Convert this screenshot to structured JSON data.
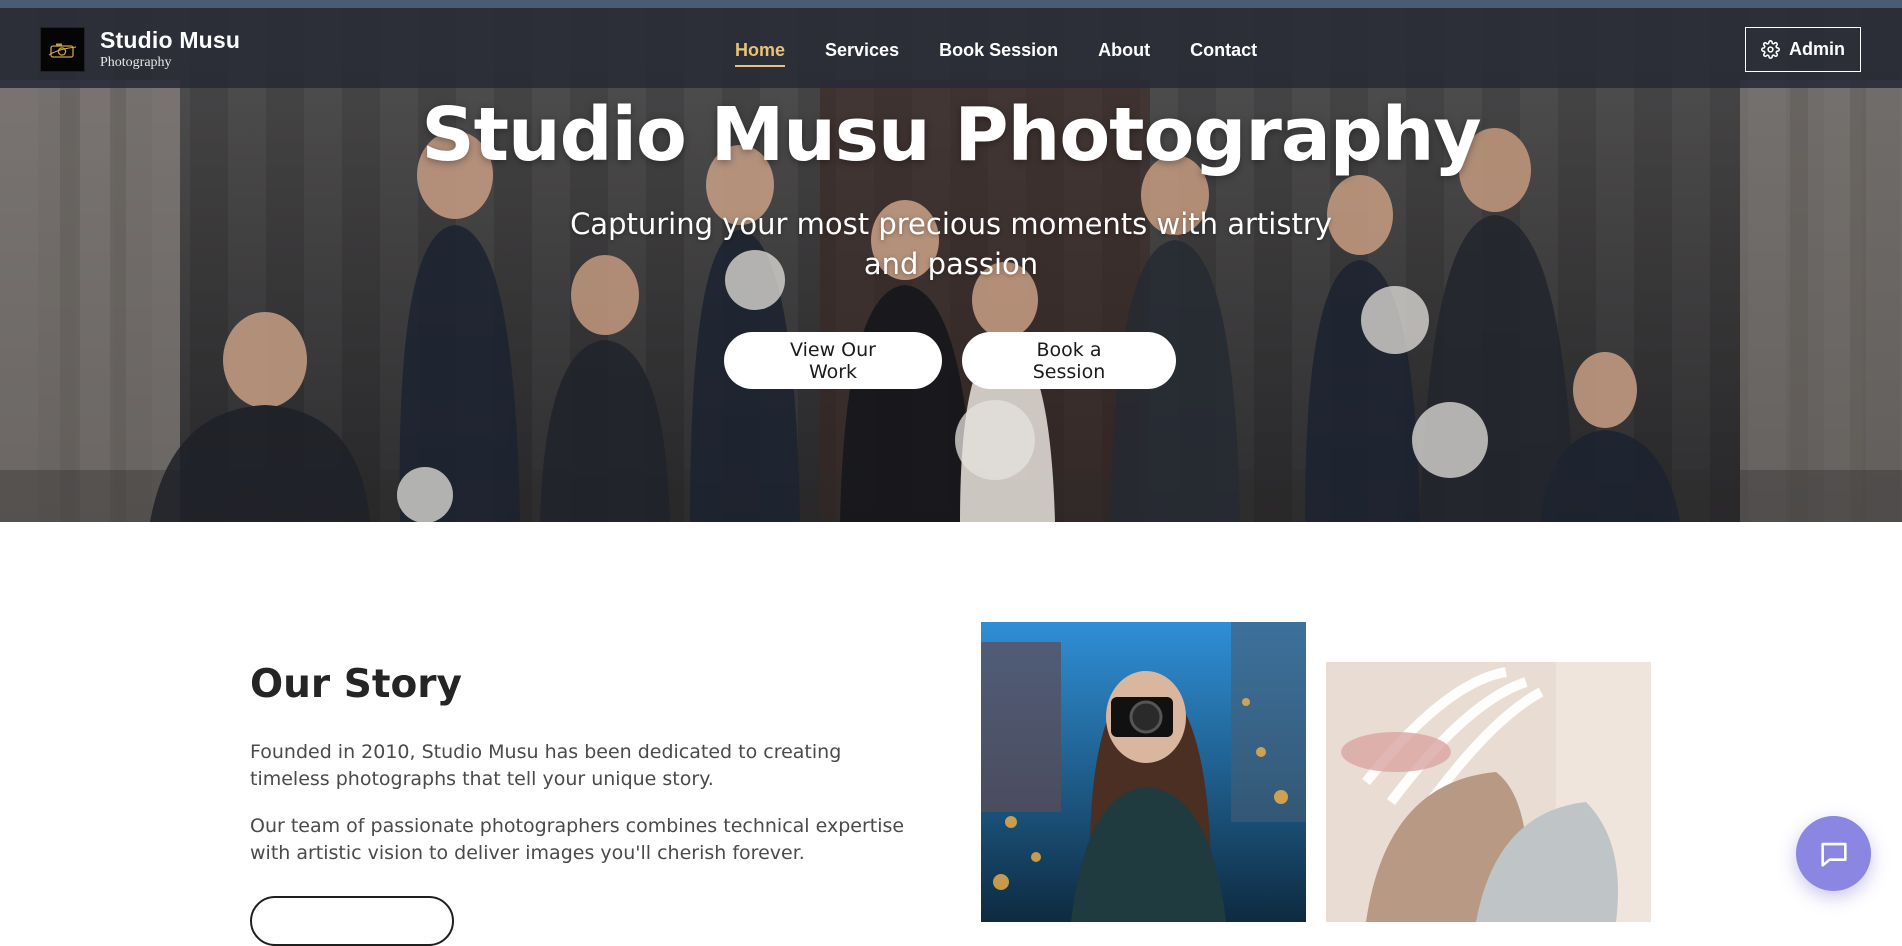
{
  "brand": {
    "name": "Studio Musu",
    "subtitle": "Photography"
  },
  "nav": {
    "links": [
      "Home",
      "Services",
      "Book Session",
      "About",
      "Contact"
    ],
    "active": "Home",
    "admin_label": "Admin"
  },
  "hero": {
    "title": "Studio Musu Photography",
    "subtitle": "Capturing your most precious moments with artistry and passion",
    "primary_button": "View Our Work",
    "secondary_button": "Book a Session"
  },
  "story": {
    "title": "Our Story",
    "paragraphs": [
      "Founded in 2010, Studio Musu has been dedicated to creating timeless photographs that tell your unique story.",
      "Our team of passionate photographers combines technical expertise with artistic vision to deliver images you'll cherish forever."
    ]
  },
  "colors": {
    "accent": "#e7c27d",
    "chat_bubble": "#8b86e2",
    "navbar": "#262a34",
    "text_dark": "#252525"
  },
  "icons": {
    "admin": "gear-icon",
    "chat": "chat-bubble-icon"
  }
}
